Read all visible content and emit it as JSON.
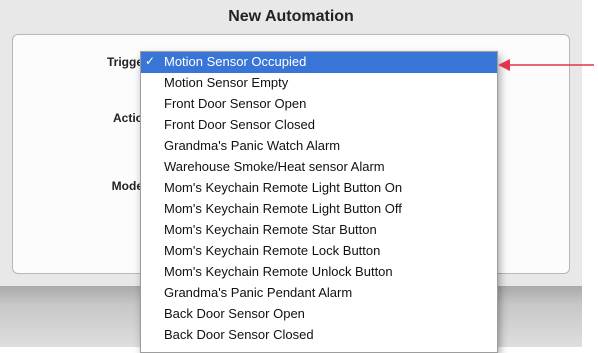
{
  "window": {
    "title": "New Automation"
  },
  "form": {
    "trigger_label": "Trigge",
    "action_label": "Actio",
    "mode_label": "Mode"
  },
  "dropdown": {
    "items": [
      {
        "label": "Motion Sensor Occupied",
        "selected": true
      },
      {
        "label": "Motion Sensor Empty"
      },
      {
        "label": "Front Door Sensor Open"
      },
      {
        "label": "Front Door Sensor Closed"
      },
      {
        "label": "Grandma's Panic Watch Alarm"
      },
      {
        "label": "Warehouse Smoke/Heat sensor Alarm"
      },
      {
        "label": "Mom's Keychain Remote Light Button On"
      },
      {
        "label": "Mom's Keychain Remote Light Button Off"
      },
      {
        "label": "Mom's Keychain Remote Star Button"
      },
      {
        "label": "Mom's Keychain Remote Lock Button"
      },
      {
        "label": "Mom's Keychain Remote Unlock Button"
      },
      {
        "label": "Grandma's Panic Pendant Alarm"
      },
      {
        "label": "Back Door Sensor Open"
      },
      {
        "label": "Back Door Sensor Closed"
      }
    ],
    "check_glyph": "✓"
  },
  "colors": {
    "selection": "#3875d7",
    "annotation_arrow": "#e0354b"
  },
  "icons": {
    "selected_indicator": "checkmark-icon",
    "annotation": "red-arrow-icon"
  }
}
